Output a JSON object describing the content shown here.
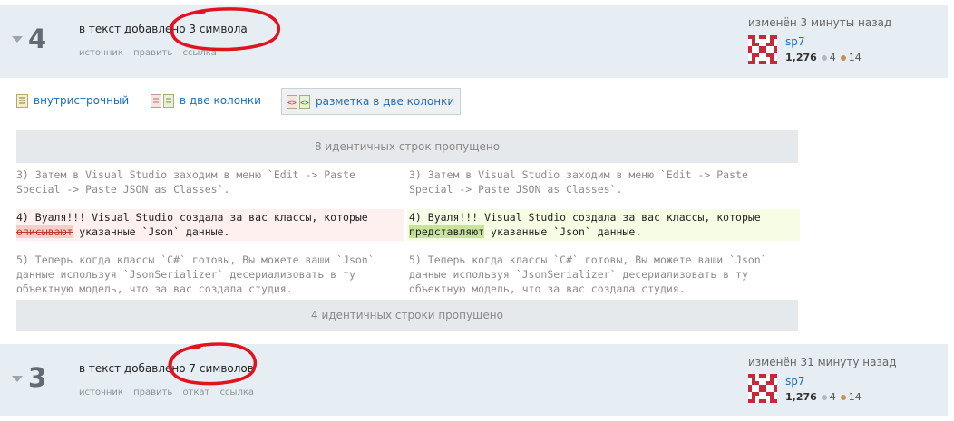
{
  "top_revision": {
    "number": "4",
    "summary": "в текст добавлено 3 символа",
    "links": [
      "источник",
      "править",
      "ссылка"
    ],
    "edited": "изменён 3 минуты назад",
    "user": {
      "name": "sp7",
      "reputation": "1,276",
      "silver": "4",
      "bronze": "14"
    }
  },
  "view_tabs": [
    {
      "label": "внутристрочный",
      "icon": "inline-view-icon"
    },
    {
      "label": "в две колонки",
      "icon": "side-by-side-icon"
    },
    {
      "label": "разметка в две колонки",
      "icon": "markup-side-by-side-icon"
    }
  ],
  "diff": {
    "skip_top": "8 идентичных строк пропущено",
    "left": {
      "line3a": "3) Затем в Visual Studio заходим в меню `Edit -> Paste",
      "line3b": "Special -> Paste JSON as Classes`.",
      "line4a": "4) Вуаля!!! Visual Studio создала за вас классы, которые",
      "line4_removed": "описывают",
      "line4b_rest": " указанные `Json` данные.",
      "line5a": "5) Теперь когда классы `C#` готовы, Вы можете ваши `Json`",
      "line5b": "данные используя `JsonSerializer` десериализовать в ту",
      "line5c": "объектную модель, что за вас создала студия."
    },
    "right": {
      "line3a": "3) Затем в Visual Studio заходим в меню `Edit -> Paste",
      "line3b": "Special -> Paste JSON as Classes`.",
      "line4a": "4) Вуаля!!! Visual Studio создала за вас классы, которые",
      "line4_added": "представляют",
      "line4b_rest": " указанные `Json` данные.",
      "line5a": "5) Теперь когда классы `C#` готовы, Вы можете ваши `Json`",
      "line5b": "данные используя `JsonSerializer` десериализовать в ту",
      "line5c": "объектную модель, что за вас создала студия."
    },
    "skip_bottom": "4 идентичных строки пропущено"
  },
  "bottom_revision": {
    "number": "3",
    "summary": "в текст добавлено 7 символов",
    "links": [
      "источник",
      "править",
      "откат",
      "ссылка"
    ],
    "edited": "изменён 31 минуту назад",
    "user": {
      "name": "sp7",
      "reputation": "1,276",
      "silver": "4",
      "bronze": "14"
    }
  },
  "colors": {
    "annotation_ring": "#e0141e",
    "link": "#1f6fb6",
    "header_bg": "#e6edf3"
  }
}
